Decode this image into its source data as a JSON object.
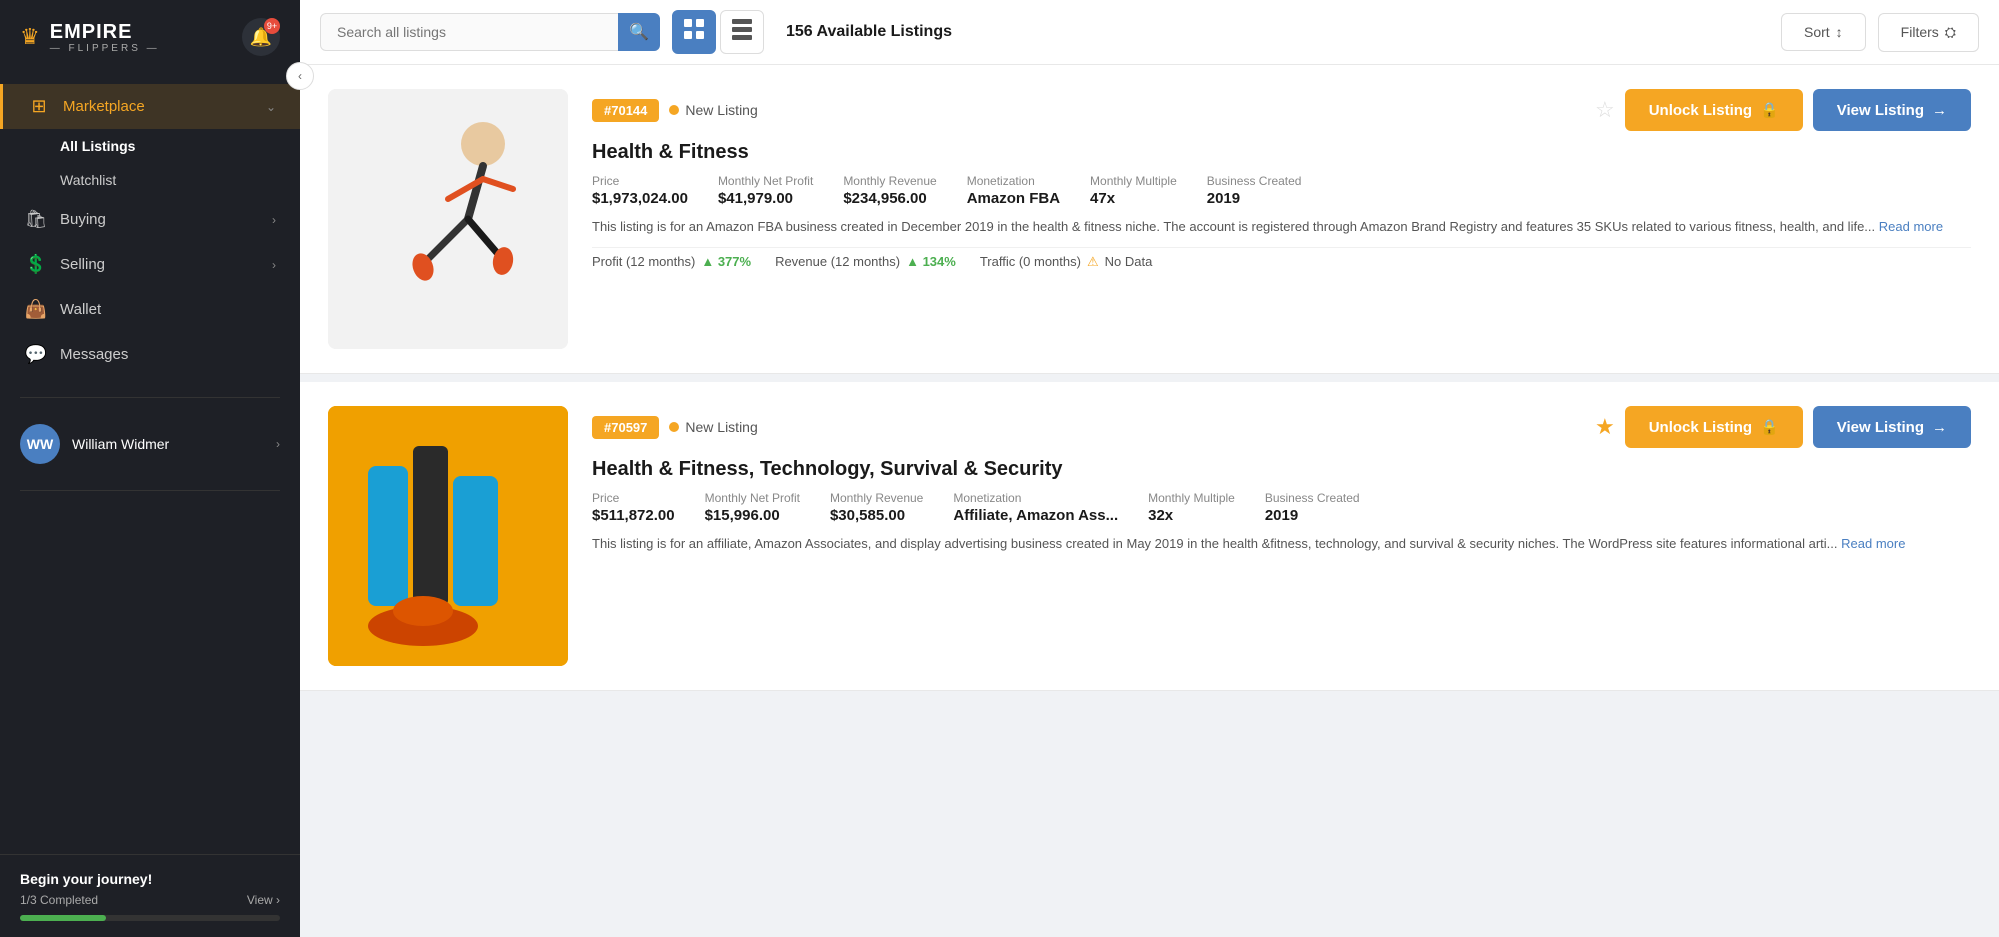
{
  "sidebar": {
    "logo": {
      "crown": "♛",
      "name": "EMPIRE",
      "sub": "— FLIPPERS —"
    },
    "notification": {
      "badge": "9+"
    },
    "nav": {
      "marketplace": {
        "label": "Marketplace",
        "icon": "⊞",
        "sub_items": [
          {
            "label": "All Listings",
            "active": true
          },
          {
            "label": "Watchlist",
            "active": false
          }
        ]
      },
      "buying": {
        "label": "Buying",
        "icon": "🛍"
      },
      "selling": {
        "label": "Selling",
        "icon": "💲"
      },
      "wallet": {
        "label": "Wallet",
        "icon": "👜"
      },
      "messages": {
        "label": "Messages",
        "icon": "💬"
      }
    },
    "user": {
      "initials": "WW",
      "name": "William Widmer"
    },
    "journey": {
      "title": "Begin your journey!",
      "progress_label": "1/3 Completed",
      "view_label": "View",
      "progress_pct": 33
    }
  },
  "topbar": {
    "search_placeholder": "Search all listings",
    "listing_count": "156 Available Listings",
    "sort_label": "Sort",
    "filters_label": "Filters"
  },
  "listings": [
    {
      "id": "#70144",
      "status": "New Listing",
      "title": "Health & Fitness",
      "starred": false,
      "image_emoji": "🏃",
      "image_bg": "#f0f0f0",
      "price_label": "Price",
      "price": "$1,973,024.00",
      "profit_label": "Monthly Net Profit",
      "profit": "$41,979.00",
      "revenue_label": "Monthly Revenue",
      "revenue": "$234,956.00",
      "monetization_label": "Monetization",
      "monetization": "Amazon FBA",
      "multiple_label": "Monthly Multiple",
      "multiple": "47x",
      "created_label": "Business Created",
      "created": "2019",
      "description": "This listing is for an Amazon FBA business created in December 2019 in the health & fitness niche. The account is registered through Amazon Brand Registry and features 35 SKUs related to various fitness, health, and life...",
      "profit_growth": "377%",
      "profit_months": "Profit (12 months)",
      "revenue_growth": "134%",
      "revenue_months": "Revenue (12 months)",
      "traffic_months": "Traffic (0 months)",
      "traffic_value": "No Data",
      "unlock_label": "Unlock Listing",
      "view_label": "View Listing"
    },
    {
      "id": "#70597",
      "status": "New Listing",
      "title": "Health & Fitness, Technology, Survival & Security",
      "starred": true,
      "image_emoji": "💪",
      "image_bg": "#f0a000",
      "price_label": "Price",
      "price": "$511,872.00",
      "profit_label": "Monthly Net Profit",
      "profit": "$15,996.00",
      "revenue_label": "Monthly Revenue",
      "revenue": "$30,585.00",
      "monetization_label": "Monetization",
      "monetization": "Affiliate, Amazon Ass...",
      "multiple_label": "Monthly Multiple",
      "multiple": "32x",
      "created_label": "Business Created",
      "created": "2019",
      "description": "This listing is for an affiliate, Amazon Associates, and display advertising business created in May 2019 in the health &fitness, technology, and survival & security niches. The WordPress site features informational arti...",
      "profit_growth": "",
      "profit_months": "",
      "revenue_growth": "",
      "revenue_months": "",
      "traffic_months": "",
      "traffic_value": "",
      "unlock_label": "Unlock Listing",
      "view_label": "View Listing"
    }
  ],
  "icons": {
    "search": "🔍",
    "sort_arrows": "↕",
    "filter": "⛭",
    "lock": "🔒",
    "arrow_right": "→",
    "grid_view": "⊞",
    "table_view": "⊟",
    "chevron_right": "›",
    "chevron_left": "‹",
    "chevron_down": "⌄",
    "bell": "🔔",
    "star_empty": "☆",
    "star_filled": "★",
    "warning": "⚠"
  }
}
